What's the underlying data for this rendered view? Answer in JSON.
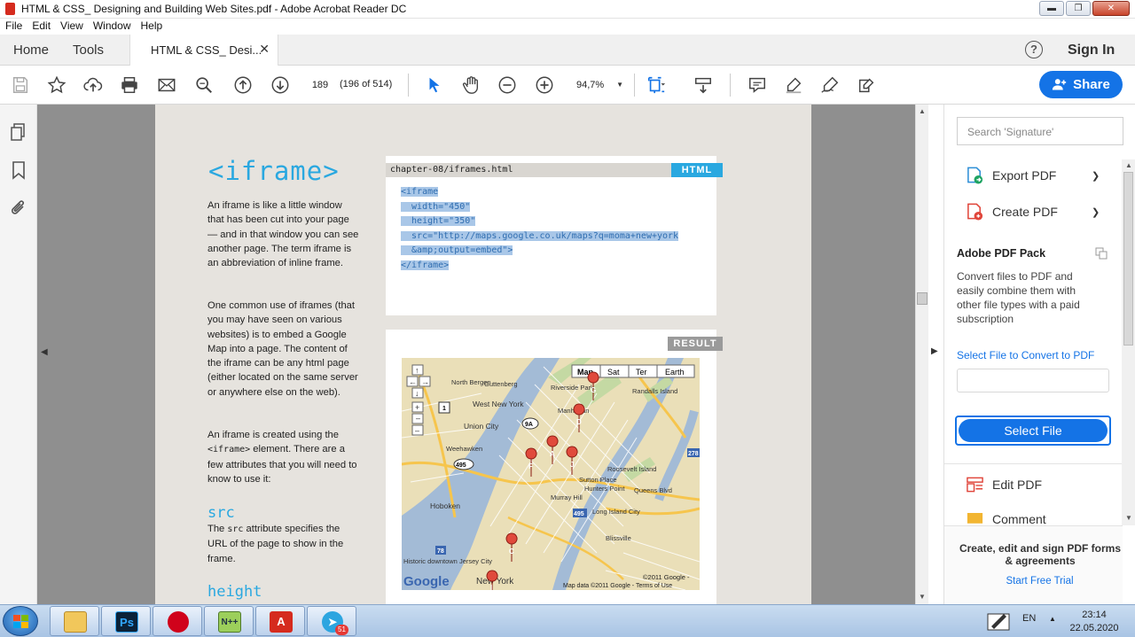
{
  "window": {
    "title": "HTML & CSS_ Designing and Building Web Sites.pdf - Adobe Acrobat Reader DC"
  },
  "menubar": [
    "File",
    "Edit",
    "View",
    "Window",
    "Help"
  ],
  "tabs": {
    "home": "Home",
    "tools": "Tools",
    "document": "HTML & CSS_ Desi...",
    "close_glyph": "✕",
    "sign_in": "Sign In",
    "help_glyph": "?"
  },
  "toolbar": {
    "page_number": "189",
    "page_count": "(196 of 514)",
    "zoom": "94,7%",
    "share": "Share",
    "accent": "#1473e6"
  },
  "pdf": {
    "title": "<iframe>",
    "para1": "An iframe is like a little window that has been cut into your page — and in that window you can see another page. The term iframe is an abbreviation of inline frame.",
    "para2": "One common use of iframes (that you may have seen on various websites) is to embed a Google Map into a page. The content of the iframe can be any html page (either located on the same server or anywhere else on the web).",
    "para3_a": "An iframe is created using the ",
    "para3_code": "<iframe>",
    "para3_b": " element. There are a few attributes that you will need to know to use it:",
    "src_heading": "src",
    "src_a": "The ",
    "src_code": "src",
    "src_b": " attribute specifies the URL of the page to show in the frame.",
    "height_heading": "height",
    "code_filename": "chapter-08/iframes.html",
    "code_tag": "HTML",
    "code_lines": [
      "<iframe",
      "  width=\"450\"",
      "  height=\"350\"",
      "  src=\"http://maps.google.co.uk/maps?q=moma+new+york",
      "  &amp;output=embed\">",
      "</iframe>"
    ],
    "result_tag": "RESULT",
    "accent": "#2aa8e0",
    "map": {
      "buttons": [
        "Map",
        "Sat",
        "Ter",
        "Earth"
      ],
      "labels": [
        "North Bergen",
        "Guttenberg",
        "West New York",
        "Union City",
        "Weehawken",
        "Manhattan",
        "Roosevelt Island",
        "Hunters Point",
        "Murray Hill",
        "Long Island City",
        "Hoboken",
        "Sutton Place",
        "Blissville",
        "Historic downtown Jersey City",
        "New York",
        "Randalls Island",
        "Queens Blvd",
        "Riverside Park"
      ],
      "markers": [
        "G",
        "D",
        "A",
        "F",
        "J",
        "C",
        "I"
      ],
      "shields": [
        "9A",
        "495",
        "1",
        "278",
        "495",
        "78"
      ],
      "google": "Google",
      "attribution": "Map data ©2011 Google - Terms of Use",
      "copyright": "©2011 Google -"
    }
  },
  "right_pane": {
    "search_placeholder": "Search 'Signature'",
    "export_pdf": "Export PDF",
    "create_pdf": "Create PDF",
    "pack_title": "Adobe PDF Pack",
    "pack_desc": "Convert files to PDF and easily combine them with other file types with a paid subscription",
    "select_link": "Select File to Convert to PDF",
    "select_button": "Select File",
    "edit_pdf": "Edit PDF",
    "comment": "Comment",
    "promo_title": "Create, edit and sign PDF forms & agreements",
    "promo_link": "Start Free Trial"
  },
  "taskbar": {
    "apps": [
      "file-explorer",
      "photoshop",
      "opera",
      "notepad++",
      "acrobat",
      "telegram"
    ],
    "telegram_badge": "51",
    "lang": "EN",
    "time": "23:14",
    "date": "22.05.2020"
  }
}
